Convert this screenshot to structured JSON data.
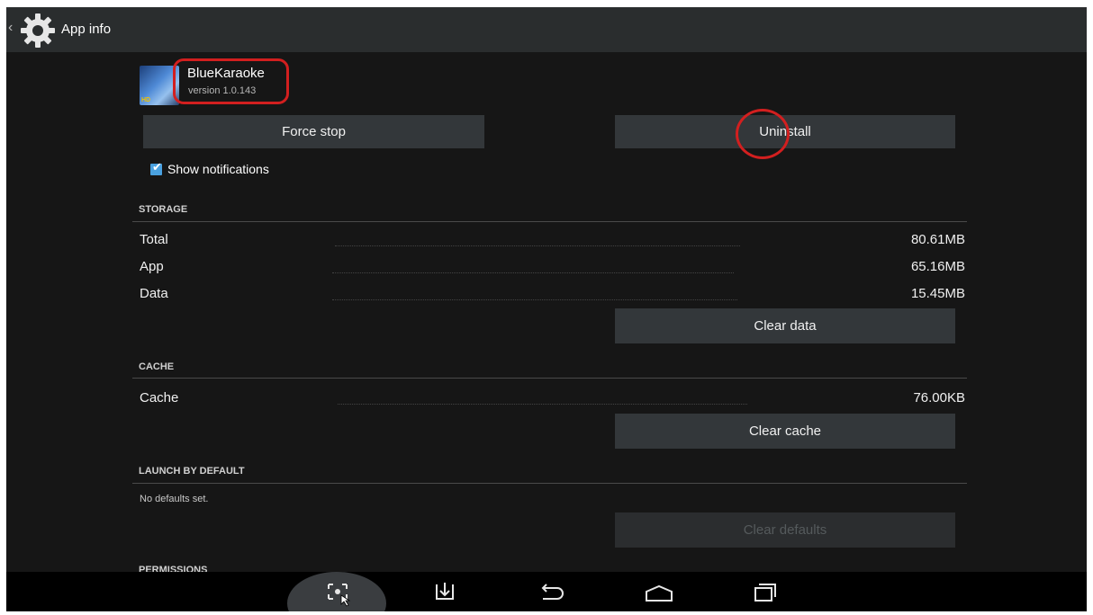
{
  "actionbar": {
    "title": "App info",
    "back_icon": "chevron-left-icon",
    "settings_icon": "gear-icon"
  },
  "app": {
    "name": "BlueKaraoke",
    "version": "version 1.0.143",
    "icon_badge": "HD"
  },
  "buttons": {
    "force_stop": "Force stop",
    "uninstall": "Uninstall",
    "clear_data": "Clear data",
    "clear_cache": "Clear cache",
    "clear_defaults": "Clear defaults"
  },
  "notifications": {
    "label": "Show notifications",
    "checked": true
  },
  "storage": {
    "header": "STORAGE",
    "rows": [
      {
        "label": "Total",
        "value": "80.61MB"
      },
      {
        "label": "App",
        "value": "65.16MB"
      },
      {
        "label": "Data",
        "value": "15.45MB"
      }
    ]
  },
  "cache": {
    "header": "CACHE",
    "label": "Cache",
    "value": "76.00KB"
  },
  "launch": {
    "header": "LAUNCH BY DEFAULT",
    "text": "No defaults set."
  },
  "permissions": {
    "header": "PERMISSIONS"
  },
  "navbar": {
    "icons": [
      "screenshot-icon",
      "download-icon",
      "back-icon",
      "home-icon",
      "recent-apps-icon"
    ]
  },
  "colors": {
    "highlight": "#d21f1f",
    "checkbox": "#4aa1e0",
    "button": "#33373a"
  }
}
